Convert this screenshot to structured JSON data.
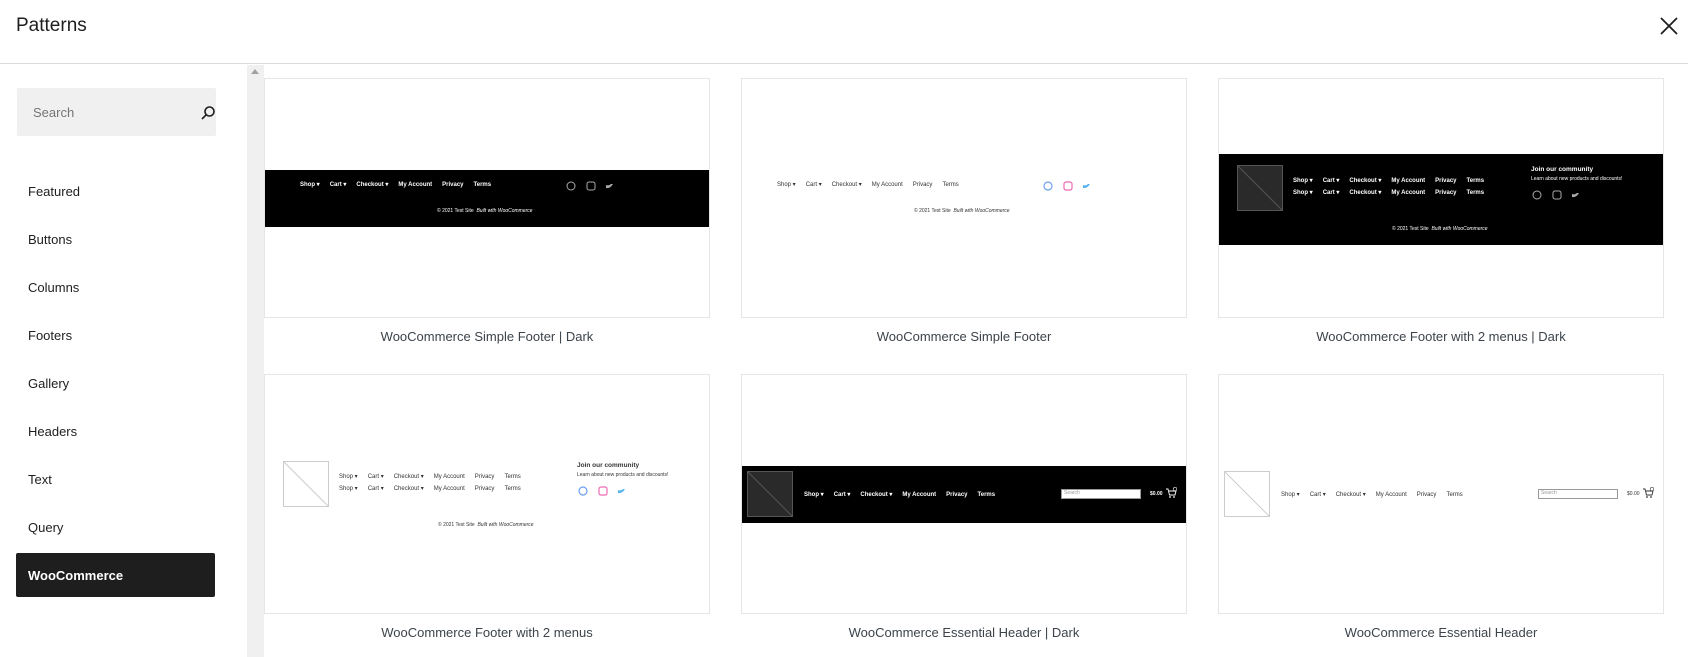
{
  "modal": {
    "title": "Patterns",
    "close_icon": "close-icon"
  },
  "search": {
    "placeholder": "Search",
    "icon": "search-icon"
  },
  "categories": [
    {
      "label": "Featured",
      "active": false
    },
    {
      "label": "Buttons",
      "active": false
    },
    {
      "label": "Columns",
      "active": false
    },
    {
      "label": "Footers",
      "active": false
    },
    {
      "label": "Gallery",
      "active": false
    },
    {
      "label": "Headers",
      "active": false
    },
    {
      "label": "Text",
      "active": false
    },
    {
      "label": "Query",
      "active": false
    },
    {
      "label": "WooCommerce",
      "active": true
    }
  ],
  "patterns": [
    {
      "label": "WooCommerce Simple Footer | Dark"
    },
    {
      "label": "WooCommerce Simple Footer"
    },
    {
      "label": "WooCommerce Footer with 2 menus | Dark"
    },
    {
      "label": "WooCommerce Footer with 2 menus"
    },
    {
      "label": "WooCommerce Essential Header | Dark"
    },
    {
      "label": "WooCommerce Essential Header"
    }
  ],
  "preview_text": {
    "nav": [
      "Shop ▾",
      "Cart ▾",
      "Checkout ▾",
      "My Account",
      "Privacy",
      "Terms"
    ],
    "copyright": "© 2021  Test Site",
    "built_with": "Built with WooCommerce",
    "join_title": "Join our community",
    "join_text": "Learn about new products and discounts!",
    "search_placeholder": "Search",
    "cart_total": "$0.00",
    "cart_count": "0"
  },
  "colors": {
    "active_bg": "#1e1e1e",
    "facebook": "#6a9ff0",
    "instagram": "#f06ab4",
    "twitter": "#5bb6f0"
  }
}
